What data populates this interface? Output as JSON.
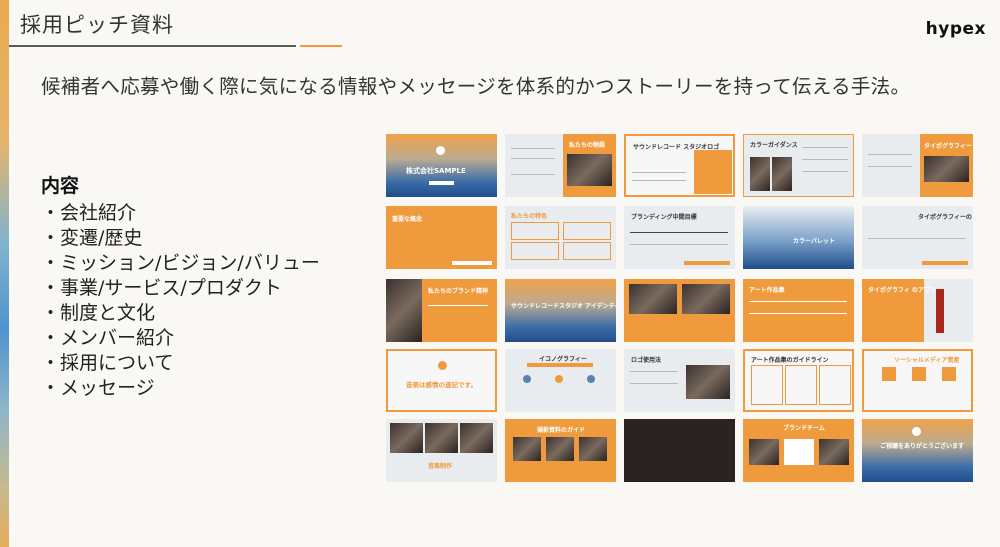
{
  "page": {
    "title": "採用ピッチ資料",
    "brand": "hypex",
    "lead": "候補者へ応募や働く際に気になる情報やメッセージを体系的かつストーリーを持って伝える手法。"
  },
  "contents": {
    "heading": "内容",
    "items": [
      "会社紹介",
      "変遷/歴史",
      "ミッション/ビジョン/バリュー",
      "事業/サービス/プロダクト",
      "制度と文化",
      "メンバー紹介",
      "採用について",
      "メッセージ"
    ]
  },
  "colors": {
    "accent": "#ef9a3c",
    "navy": "#1f4e8c",
    "text": "#333333"
  },
  "thumbnails": [
    {
      "label": "株式会社SAMPLE"
    },
    {
      "label": "私たちの物語"
    },
    {
      "label": "サウンドレコード スタジオロゴ"
    },
    {
      "label": "カラーガイダンス"
    },
    {
      "label": "タイポグラフィー"
    },
    {
      "label": "重要な概念"
    },
    {
      "label": "私たちの特色"
    },
    {
      "label": "ブランディング中間目標"
    },
    {
      "label": "カラーパレット"
    },
    {
      "label": "タイポグラフィーの ガイドライン"
    },
    {
      "label": "私たちのブランド精神"
    },
    {
      "label": "サウンドレコードスタジオ アイデンティティ"
    },
    {
      "label": ""
    },
    {
      "label": "アート作品集"
    },
    {
      "label": "タイポグラフィ のアプリ"
    },
    {
      "label": "音楽は感情の速記です。"
    },
    {
      "label": "イコノグラフィー"
    },
    {
      "label": "ロゴ使用法"
    },
    {
      "label": "アート作品集のガイドライン"
    },
    {
      "label": "ソーシャルメディア資産"
    },
    {
      "label": "音楽制作"
    },
    {
      "label": "撮影資料のガイド"
    },
    {
      "label": ""
    },
    {
      "label": "ブランドチーム"
    },
    {
      "label": "ご視聴をありがとうございます"
    }
  ]
}
